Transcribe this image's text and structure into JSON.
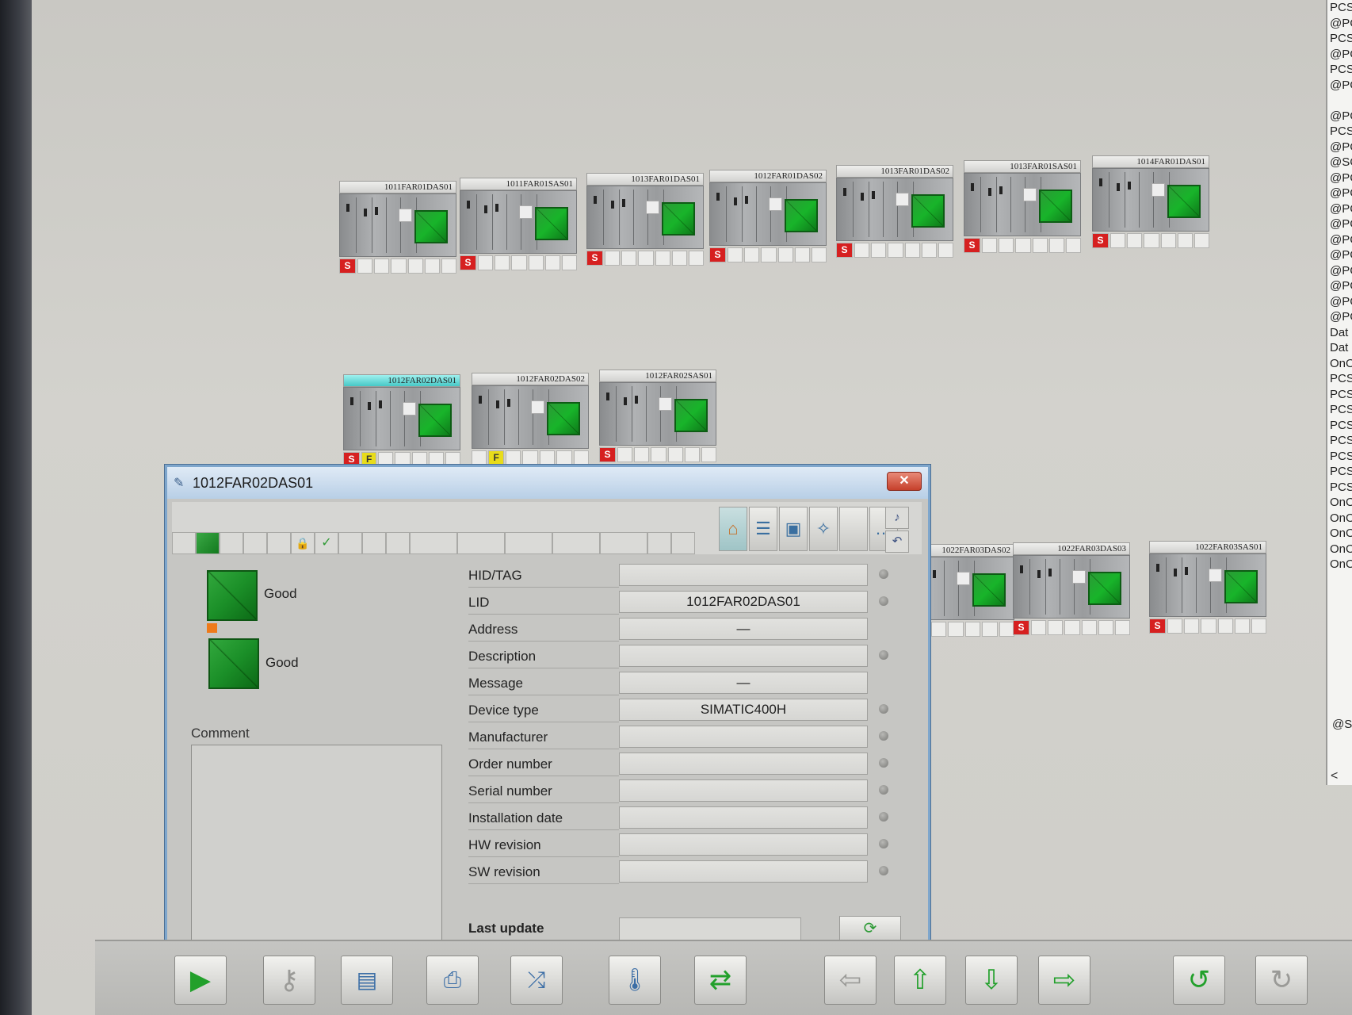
{
  "right_panel": {
    "lines": [
      "PCS",
      "@PC",
      "PCS",
      "@PC",
      "PCS",
      "@PC",
      "",
      "@PC",
      "PCS",
      "@PC",
      "@SC",
      "@PC",
      "@PC",
      "@PC",
      "@PC",
      "@PC",
      "@PC",
      "@PC",
      "@PC",
      "@PC",
      "@PC",
      "Dat",
      "Dat",
      "OnO",
      "PCS",
      "PCS",
      "PCS",
      "PCS",
      "PCS",
      "PCS",
      "PCS",
      "PCS",
      "OnO",
      "OnO",
      "OnO",
      "OnO",
      "OnO"
    ],
    "bottom_text": "@S",
    "scroll_left": "<"
  },
  "row1_tiles": [
    {
      "label": "1011FAR01DAS01",
      "s": "S",
      "f": ""
    },
    {
      "label": "1011FAR01SAS01",
      "s": "S",
      "f": ""
    },
    {
      "label": "1013FAR01DAS01",
      "s": "S",
      "f": ""
    },
    {
      "label": "1012FAR01DAS02",
      "s": "S",
      "f": ""
    },
    {
      "label": "1013FAR01DAS02",
      "s": "S",
      "f": ""
    },
    {
      "label": "1013FAR01SAS01",
      "s": "S",
      "f": ""
    },
    {
      "label": "1014FAR01DAS01",
      "s": "S",
      "f": ""
    }
  ],
  "row2_tiles": [
    {
      "label": "1012FAR02DAS01",
      "s": "S",
      "f": "F"
    },
    {
      "label": "1012FAR02DAS02",
      "s": "",
      "f": "F"
    },
    {
      "label": "1012FAR02SAS01",
      "s": "S",
      "f": ""
    }
  ],
  "row3_tiles": [
    {
      "label": "1022FAR03DAS02",
      "s": "",
      "f": ""
    },
    {
      "label": "1022FAR03DAS03",
      "s": "S",
      "f": ""
    },
    {
      "label": "1022FAR03SAS01",
      "s": "S",
      "f": ""
    }
  ],
  "dialog": {
    "title": "1012FAR02DAS01",
    "close": "✕",
    "state1": "Good",
    "state2": "Good",
    "comment_label": "Comment",
    "properties": [
      {
        "key": "HID/TAG",
        "value": "",
        "dot": true
      },
      {
        "key": "LID",
        "value": "1012FAR02DAS01",
        "dot": true
      },
      {
        "key": "Address",
        "value": "—",
        "dot": false
      },
      {
        "key": "Description",
        "value": "",
        "dot": true
      },
      {
        "key": "Message",
        "value": "—",
        "dot": false
      },
      {
        "key": "Device type",
        "value": "SIMATIC400H",
        "dot": true
      },
      {
        "key": "Manufacturer",
        "value": "",
        "dot": true
      },
      {
        "key": "Order number",
        "value": "",
        "dot": true
      },
      {
        "key": "Serial number",
        "value": "",
        "dot": true
      },
      {
        "key": "Installation date",
        "value": "",
        "dot": true
      },
      {
        "key": "HW revision",
        "value": "",
        "dot": true
      },
      {
        "key": "SW revision",
        "value": "",
        "dot": true
      }
    ],
    "last_update_label": "Last update",
    "last_update_value": ""
  },
  "colors": {
    "accent_green": "#1b9a2a",
    "s_red": "#d62020",
    "f_yellow": "#e8dc1a",
    "selected_cyan": "#46c8c6"
  }
}
